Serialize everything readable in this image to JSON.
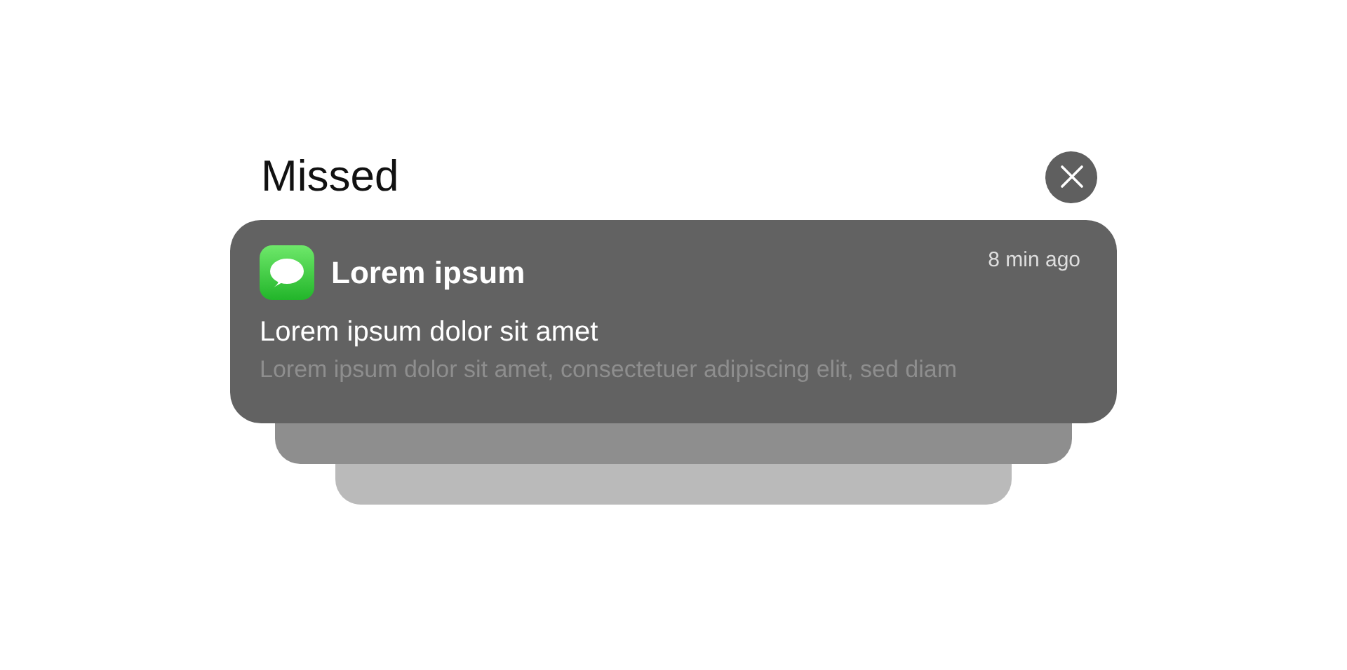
{
  "header": {
    "title": "Missed",
    "close_button": {
      "kind": "close"
    }
  },
  "notification": {
    "app_name": "Lorem ipsum",
    "time": "8 min ago",
    "title": "Lorem ipsum dolor sit amet",
    "body": "Lorem ipsum dolor sit amet, consectetuer adipiscing elit, sed diam"
  },
  "stacked_notifications": [
    {
      "kind": "collapsed"
    },
    {
      "kind": "collapsed"
    }
  ]
}
